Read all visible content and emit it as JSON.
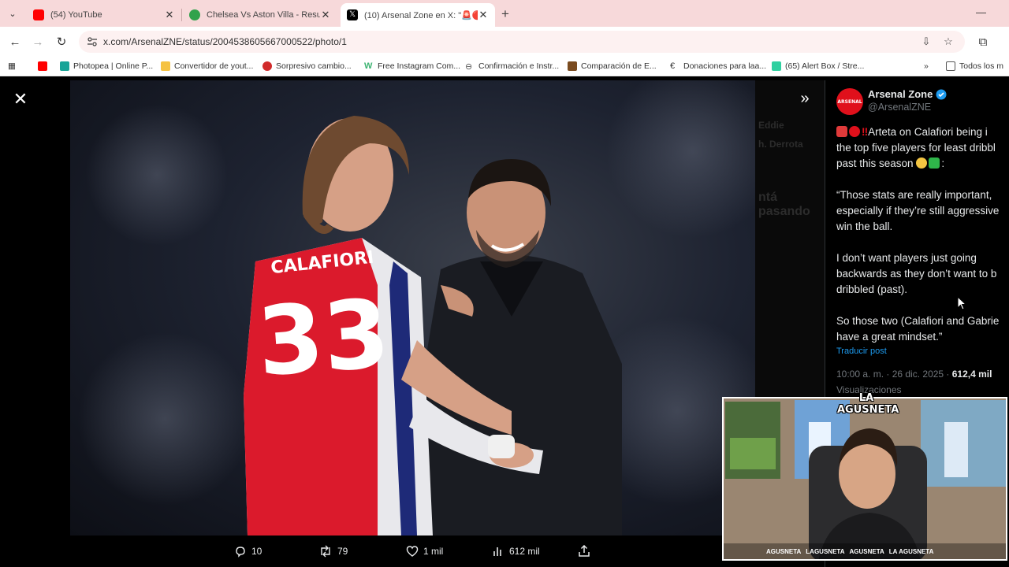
{
  "browser": {
    "tabs": [
      {
        "title": "(54) YouTube",
        "favicon": "youtube-icon",
        "color": "#ff0000"
      },
      {
        "title": "Chelsea Vs Aston Villa - Resulta",
        "favicon": "soccer-ball-icon",
        "color": "#31a24c"
      },
      {
        "title": "(10) Arsenal Zone en X: \"🚨🔴",
        "favicon": "x-logo-icon",
        "color": "#000000",
        "active": true
      }
    ],
    "url": "x.com/ArsenalZNE/status/2004538605667000522/photo/1",
    "bookmarks": [
      {
        "label": "",
        "icon": "youtube-icon",
        "color": "#ff0000"
      },
      {
        "label": "Photopea | Online P...",
        "icon": "photopea-icon",
        "color": "#18a497"
      },
      {
        "label": "Convertidor de yout...",
        "icon": "folder-yellow-icon",
        "color": "#f5c242"
      },
      {
        "label": "Sorpresivo cambio...",
        "icon": "news-icon",
        "color": "#d12b2b"
      },
      {
        "label": "Free Instagram Com...",
        "icon": "w-icon",
        "color": "#3cb371"
      },
      {
        "label": "Confirmación e Instr...",
        "icon": "link-icon",
        "color": "#555555"
      },
      {
        "label": "Comparación de E...",
        "icon": "bookmark-brown-icon",
        "color": "#7a4b1f"
      },
      {
        "label": "Donaciones para laa...",
        "icon": "euro-icon",
        "color": "#333333"
      },
      {
        "label": "(65) Alert Box / Stre...",
        "icon": "alertbox-icon",
        "color": "#2fd0a0"
      }
    ],
    "all_bookmarks": "Todos los m"
  },
  "post": {
    "name": "Arsenal Zone",
    "handle": "@ArsenalZNE",
    "avatar_text": "ARSENAL",
    "lines": [
      [
        "Arteta on Calafiori being i",
        "the top five players for least dribbl",
        "past this season "
      ],
      [
        "“Those stats are really important,",
        "especially if they’re still aggressive",
        "win the ball."
      ],
      [
        "I don’t want players just going",
        "backwards as they don’t want to b",
        "dribbled (past)."
      ],
      [
        "So those two (Calafiori and Gabrie",
        "have a great mindset.”"
      ]
    ],
    "colon": ":",
    "translate": "Traducir post",
    "time": "10:00 a. m. · 26 dic. 2025 · ",
    "views": "612,4 mil",
    "views_label": "Visualizaciones",
    "metrics": {
      "replies": "10",
      "reposts": "79",
      "likes": "1 mil",
      "views": "612 mil"
    },
    "photo": {
      "name": "CALAFIORI",
      "number": "33"
    }
  },
  "background_text": [
    "Eddie",
    "h. Derrota",
    "ntá pasando"
  ],
  "stream": {
    "logo": "LA AGUSNETA",
    "socials": [
      "AGUSNETA",
      "LAGUSNETA",
      "AGUSNETA",
      "LA AGUSNETA"
    ]
  }
}
